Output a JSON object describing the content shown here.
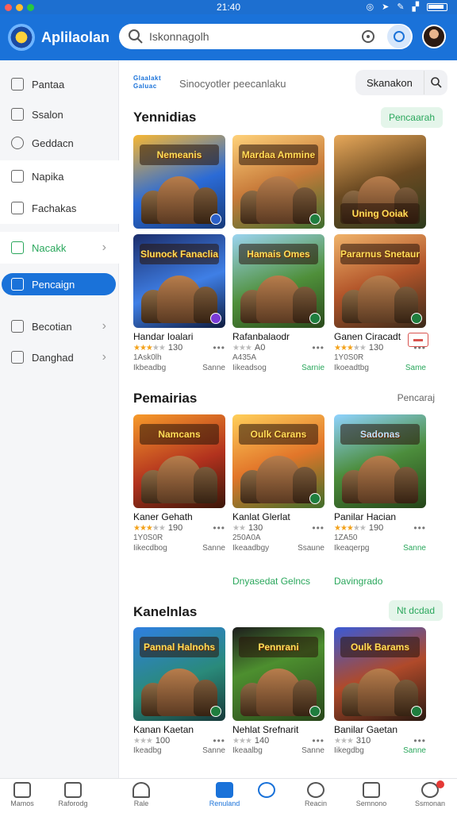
{
  "status_bar": {
    "time": "21:40"
  },
  "header": {
    "app_name": "Aplilaolan",
    "search_placeholder": "Iskonnagolh"
  },
  "sidebar": {
    "items": [
      {
        "label": "Pantaa",
        "icon": "store-icon"
      },
      {
        "label": "Ssalon",
        "icon": "check-box-icon"
      },
      {
        "label": "Geddacn",
        "icon": "gear-icon"
      },
      {
        "label": "Napika",
        "icon": "image-icon"
      },
      {
        "label": "Fachakas",
        "icon": "shield-icon"
      },
      {
        "label": "Nacakk",
        "icon": "calendar-icon",
        "chevron": "›"
      },
      {
        "label": "Pencaign",
        "icon": "bookmark-icon"
      },
      {
        "label": "Becotian",
        "icon": "grid-icon",
        "chevron": "›"
      },
      {
        "label": "Danghad",
        "icon": "download-icon",
        "chevron": "›"
      }
    ]
  },
  "topbar": {
    "brand": "Glaalakt Galuac",
    "subtitle": "Sinocyotler peecanlaku",
    "sort_label": "Skanakon"
  },
  "sections": [
    {
      "title": "Yennidias",
      "action": "Pencaarah",
      "games": [
        {
          "art": "Nemeanis",
          "name": "",
          "rating": 0,
          "rating_text": "",
          "installs": "",
          "developer": "",
          "action": ""
        },
        {
          "art": "Mardaa Ammine",
          "name": "",
          "rating": 0,
          "rating_text": "",
          "installs": "",
          "developer": "",
          "action": ""
        },
        {
          "art": "Uning Ooiak",
          "name": "",
          "rating": 0,
          "rating_text": "",
          "installs": "",
          "developer": "",
          "action": ""
        },
        {
          "art": "Slunock Fanaclia",
          "name": "Handar Ioalari",
          "rating": 3,
          "rating_text": "130",
          "installs": "1Ask0lh",
          "developer": "Ikbeadbg",
          "action": "Sanne"
        },
        {
          "art": "Hamais Omes",
          "name": "Rafanbalaodr",
          "rating": 3,
          "rating_text": "A0",
          "installs": "A435A",
          "developer": "Iikeadsog",
          "action": "Sarnie"
        },
        {
          "art": "Pararnus Snetaun",
          "name": "Ganen Ciracadt",
          "rating": 3,
          "rating_text": "130",
          "installs": "1Y0S0R",
          "developer": "Ikoeadtbg",
          "action": "Same"
        }
      ]
    },
    {
      "title": "Pemairias",
      "action": "Pencaraj",
      "games": [
        {
          "art": "Namcans",
          "name": "Kaner Gehath",
          "rating": 3,
          "rating_text": "190",
          "installs": "1Y0S0R",
          "developer": "Iikecdbog",
          "action": "Sanne"
        },
        {
          "art": "Oulk Carans",
          "name": "Kanlat Glerlat",
          "rating": 3,
          "rating_text": "130",
          "installs": "250A0A",
          "developer": "Ikeaadbgy",
          "action": "Ssaune"
        },
        {
          "art": "Sadonas",
          "name": "Panilar Hacian",
          "rating": 3,
          "rating_text": "190",
          "installs": "1ZA50",
          "developer": "Ikeaqerpg",
          "action": "Sanne"
        }
      ],
      "links": [
        "Dnyasedat Gelncs",
        "Davingrado"
      ]
    },
    {
      "title": "Kanelnlas",
      "action": "Nt dcdad",
      "games": [
        {
          "art": "Pannal Halnohs",
          "name": "Kanan Kaetan",
          "rating": 2,
          "rating_text": "100",
          "installs": "",
          "developer": "Ikeadbg",
          "action": "Sanne"
        },
        {
          "art": "Pennrani",
          "name": "Nehlat Srefnarit",
          "rating": 2,
          "rating_text": "140",
          "installs": "",
          "developer": "Ikeaalbg",
          "action": "Sanne"
        },
        {
          "art": "Oulk Barams",
          "name": "Banilar Gaetan",
          "rating": 2,
          "rating_text": "310",
          "installs": "",
          "developer": "Iikegdbg",
          "action": "Sanne"
        }
      ]
    }
  ],
  "bottom_nav": [
    {
      "label": "Mamos",
      "icon": "home-icon"
    },
    {
      "label": "Raforodg",
      "icon": "list-icon"
    },
    {
      "label": "Rale",
      "icon": "tools-icon"
    },
    {
      "label": "Renuland",
      "icon": "apps-icon",
      "active": true
    },
    {
      "label": "",
      "icon": "compass-icon"
    },
    {
      "label": "Reacin",
      "icon": "person-icon"
    },
    {
      "label": "Semnono",
      "icon": "chart-icon"
    },
    {
      "label": "Ssmonan",
      "icon": "account-icon",
      "badge": true
    }
  ],
  "colors": {
    "primary": "#1a72d9",
    "accent_green": "#2aa75c",
    "star": "#f3a21b"
  }
}
